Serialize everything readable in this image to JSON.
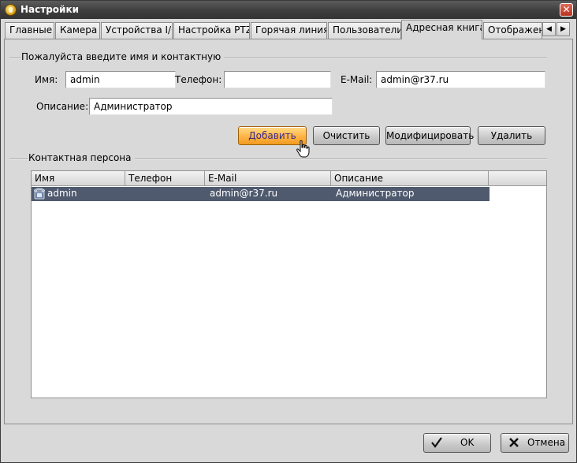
{
  "window": {
    "title": "Настройки",
    "close_symbol": "✕"
  },
  "tabs": [
    {
      "label": "Главные"
    },
    {
      "label": "Камера"
    },
    {
      "label": "Устройства I/O"
    },
    {
      "label": "Настройка PTZ"
    },
    {
      "label": "Горячая линия"
    },
    {
      "label": "Пользователи"
    },
    {
      "label": "Адресная книга",
      "active": true
    },
    {
      "label": "Отображени"
    }
  ],
  "tab_scroll": {
    "left": "◀",
    "right": "▶"
  },
  "form": {
    "group_title": "Пожалуйста введите имя и контактную",
    "name_label": "Имя:",
    "name_value": "admin",
    "phone_label": "Телефон:",
    "phone_value": "",
    "email_label": "E-Mail:",
    "email_value": "admin@r37.ru",
    "desc_label": "Описание:",
    "desc_value": "Администратор"
  },
  "actions": {
    "add": "Добавить",
    "clear": "Очистить",
    "modify": "Модифицировать",
    "delete": "Удалить"
  },
  "contacts": {
    "group_title": "Контактная персона",
    "columns": [
      "Имя",
      "Телефон",
      "E-Mail",
      "Описание"
    ],
    "rows": [
      {
        "icon": "phone-icon",
        "name": "admin",
        "phone": "",
        "email": "admin@r37.ru",
        "description": "Администратор"
      }
    ]
  },
  "footer": {
    "ok": "OK",
    "cancel": "Отмена"
  },
  "colors": {
    "accent": "#ffb445",
    "selection": "#4f5a6e",
    "titlebar": "#3e3e3e"
  }
}
